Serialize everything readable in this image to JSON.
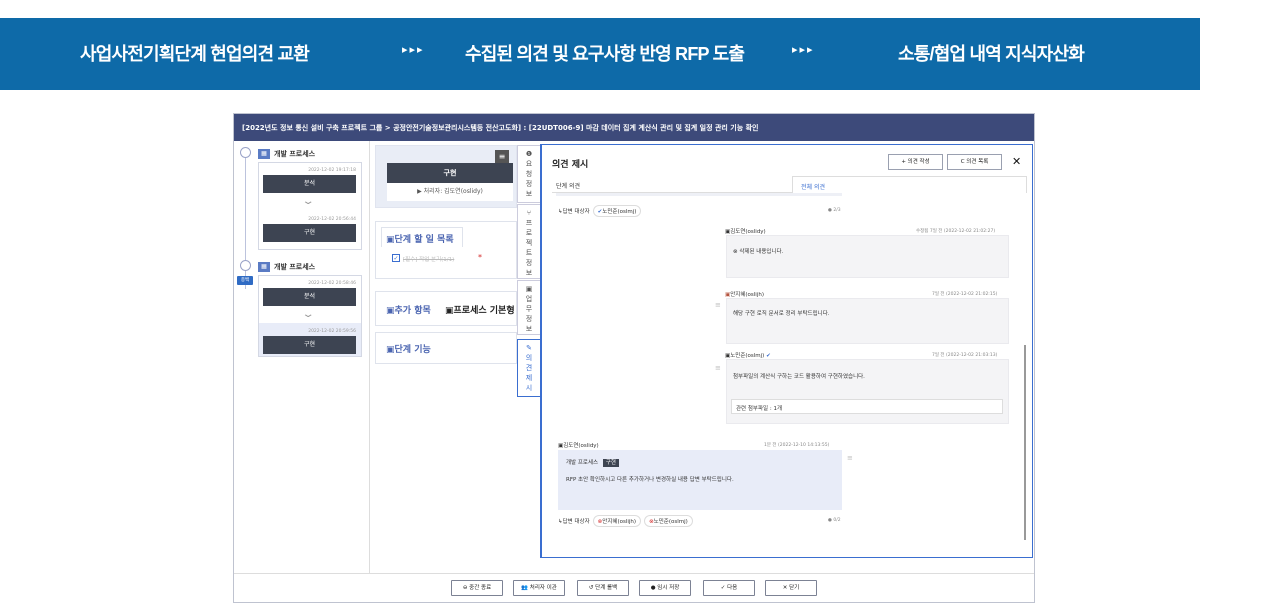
{
  "banner": {
    "step1": "사업사전기획단계 현업의견 교환",
    "chev1": "▸▸▸",
    "step2": "수집된 의견 및 요구사항 반영 RFP 도출",
    "chev2": "▸▸▸",
    "step3": "소통/협업 내역 지식자산화",
    "color": "#0e6aa8"
  },
  "window": {
    "title": "[2022년도 정보 통신 설비 구축 프로젝트 그룹 > 공정안전기술정보관리시스템등 전산고도화] : [22UDT006-9] 마감 데이터 집계 계산식 관리 및 집계 일정 관리 기능 확인"
  },
  "left": {
    "process1": {
      "label": "개발 프로세스",
      "steps": [
        {
          "date": "2022-12-02 19:17:18",
          "name": "분석"
        },
        {
          "date": "2022-12-02 20:56:44",
          "name": "구현"
        }
      ]
    },
    "process2": {
      "label": "개발 프로세스",
      "badge": "종백",
      "steps": [
        {
          "date": "2022-12-02 20:58:46",
          "name": "분석"
        },
        {
          "date": "2022-12-02 20:59:56",
          "name": "구현"
        }
      ]
    }
  },
  "middle": {
    "current_step": "구현",
    "handler": "처리자: 김도연(oslidy)",
    "todo_title": "단계 할 일 목록",
    "todo_item": "[필수] 작업 분기(1/1)",
    "add_items": "추가 항목",
    "process_basic": "프로세스 기본형",
    "step_function": "단계 기능"
  },
  "vtabs": [
    {
      "icon": "❶",
      "label": "요\n청\n정\n보"
    },
    {
      "icon": "⑂",
      "label": "프\n로\n젝\n트\n정\n보"
    },
    {
      "icon": "▣",
      "label": "업\n무\n정\n보"
    },
    {
      "icon": "✎",
      "label": "의\n견\n제\n시"
    }
  ],
  "opinion": {
    "title": "의견 제시",
    "write_btn": "+ 의견 작성",
    "list_btn": "C 의견 목록",
    "close": "✕",
    "tab_step": "단계 의견",
    "tab_all": "전체 의견",
    "reply_target_label": "↳답변 대상자",
    "reply1_target": "노민준(oslmj)",
    "reply1_count": "2/3",
    "c1_author": "김도연(oslidy)",
    "c1_meta": "수정됨 7일 전 (2022-12-02 21:02:27)",
    "c1_text": "⊗ 삭제된 내용입니다.",
    "c2_author": "안지혜(oslijh)",
    "c2_meta": "7일 전 (2022-12-02 21:02:15)",
    "c2_text": "해당 구현 로직 문서로 정리 부탁드립니다.",
    "c3_author": "노민준(oslmj)",
    "c3_meta": "7일 전 (2022-12-02 21:03:13)",
    "c3_text": "첨부파일의 계산식 구하는 코드 활용하여 구현하였습니다.",
    "c3_attach": "관련 첨부파일 : 1개",
    "c4_author": "김도연(oslidy)",
    "c4_meta": "1분 전 (2022-12-10 14:13:55)",
    "c4_tag_proc": "개발 프로세스",
    "c4_tag_step": "구현",
    "c4_text": "RFP 초안 확인하시고 다른 추가하거나 변경하실 내용 답변 부탁드립니다.",
    "reply2_target_a": "안지혜(oslijh)",
    "reply2_target_b": "노민준(oslmj)",
    "reply2_count": "0/2"
  },
  "bottom": {
    "b1": "⊖ 중간 종료",
    "b2": "처리자 이관",
    "b3": "↺ 단계 롤백",
    "b4": "임시 저장",
    "b5": "✓ 다음",
    "b6": "✕ 닫기"
  }
}
